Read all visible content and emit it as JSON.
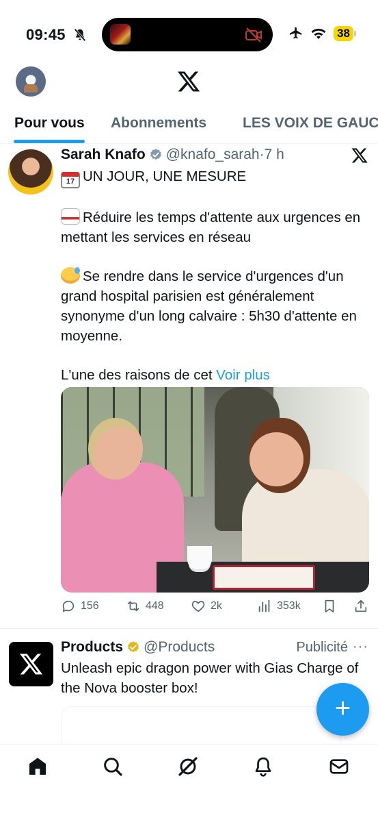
{
  "status_bar": {
    "time": "09:45",
    "battery": "38"
  },
  "header": {
    "logo": "x-logo"
  },
  "tabs": [
    {
      "label": "Pour vous",
      "active": true
    },
    {
      "label": "Abonnements",
      "active": false
    },
    {
      "label": "LES VOIX DE GAUC",
      "active": false
    }
  ],
  "tweet": {
    "display_name": "Sarah Knafo",
    "handle": "@knafo_sarah",
    "separator": "·",
    "time_ago": "7 h",
    "emoji_calendar_text": "17",
    "line1": "UN JOUR, UNE MESURE",
    "line2": "Réduire les temps d'attente aux urgences en mettant les services en réseau",
    "line3": "Se rendre dans le service d'urgences d'un grand hospital parisien est généralement synonyme d'un long calvaire : 5h30 d'attente en moyenne.",
    "line4": "L'une des raisons de cet",
    "show_more": "Voir plus",
    "stats": {
      "replies": "156",
      "reposts": "448",
      "likes": "2k",
      "views": "353k"
    }
  },
  "ad": {
    "display_name": "Products",
    "handle": "@Products",
    "label": "Publicité",
    "more": "···",
    "text": "Unleash epic dragon power with Gias Charge of the Nova booster box!"
  },
  "fab": {
    "label": "+"
  },
  "colors": {
    "accent": "#1d9bf0",
    "text_primary": "#0f1419",
    "text_secondary": "#536471",
    "battery": "#f7d600"
  }
}
